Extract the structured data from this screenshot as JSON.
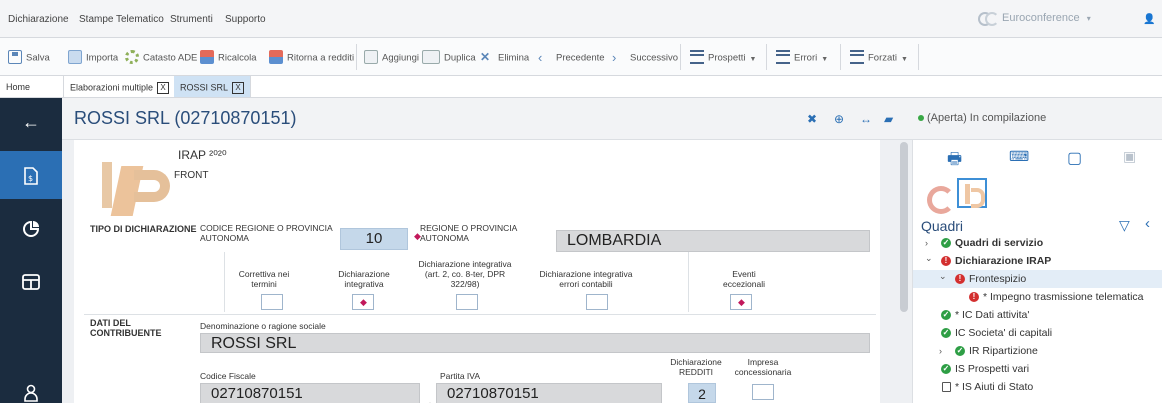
{
  "menu": {
    "items": [
      "Dichiarazione",
      "Stampe",
      "Telematico",
      "Strumenti",
      "Supporto"
    ],
    "brand": "Euroconference",
    "brand_caret": "▾"
  },
  "toolbar": {
    "salva": "Salva",
    "importa": "Importa",
    "catasto": "Catasto ADE",
    "ricalcola": "Ricalcola",
    "ritorna": "Ritorna a redditi",
    "aggiungi": "Aggiungi",
    "duplica": "Duplica",
    "elimina": "Elimina",
    "precedente": "Precedente",
    "successivo": "Successivo",
    "prospetti": "Prospetti",
    "errori": "Errori",
    "forzati": "Forzati"
  },
  "tabs": {
    "home": "Home",
    "elaborazioni": "Elaborazioni multiple",
    "rossi": "ROSSI SRL",
    "close_glyph": "X"
  },
  "header": {
    "title": "ROSSI SRL (02710870151)",
    "status": "(Aperta) In compilazione"
  },
  "form": {
    "irap_title": "IRAP ²⁰²⁰",
    "irap_sub": "FRONT",
    "tipo_label": "TIPO DI DICHIARAZIONE",
    "codice_regione_label": "CODICE REGIONE O PROVINCIA AUTONOMA",
    "codice_regione_value": "10",
    "regione_label": "REGIONE O PROVINCIA AUTONOMA",
    "regione_value": "LOMBARDIA",
    "correttiva_label": "Correttiva nei termini",
    "integrativa_label": "Dichiarazione integrativa",
    "integrativa_art_label": "Dichiarazione integrativa (art. 2, co. 8-ter, DPR 322/98)",
    "integrativa_err_label": "Dichiarazione integrativa errori contabili",
    "eventi_label": "Eventi eccezionali",
    "dati_label": "DATI DEL CONTRIBUENTE",
    "denominazione_label": "Denominazione o ragione sociale",
    "denominazione_value": "ROSSI SRL",
    "cf_label": "Codice Fiscale",
    "cf_value": "02710870151",
    "piva_label": "Partita IVA",
    "piva_value": "02710870151",
    "redditi_label": "Dichiarazione REDDITI",
    "redditi_value": "2",
    "impresa_label": "Impresa concessionaria"
  },
  "panel": {
    "quadri_title": "Quadri",
    "tree": [
      {
        "label": "Quadri di servizio",
        "status": "ok",
        "bold": true,
        "chev": "›"
      },
      {
        "label": "Dichiarazione IRAP",
        "status": "err",
        "bold": true,
        "chev": "⌄"
      },
      {
        "label": "Frontespizio",
        "status": "err",
        "bold": false,
        "chev": "⌄"
      },
      {
        "label": "* Impegno trasmissione telematica",
        "status": "err",
        "bold": false,
        "chev": ""
      },
      {
        "label": "* IC Dati attivita'",
        "status": "ok",
        "bold": false,
        "chev": ""
      },
      {
        "label": "IC Societa' di capitali",
        "status": "ok",
        "bold": false,
        "chev": ""
      },
      {
        "label": "IR Ripartizione",
        "status": "ok",
        "bold": false,
        "chev": "›"
      },
      {
        "label": "IS Prospetti vari",
        "status": "ok",
        "bold": false,
        "chev": ""
      },
      {
        "label": "* IS Aiuti di Stato",
        "status": "doc",
        "bold": false,
        "chev": ""
      }
    ]
  },
  "icons": {
    "back": "back-arrow-icon",
    "doc": "document-icon",
    "chart": "pie-chart-icon",
    "table": "table-icon",
    "user": "user-icon"
  }
}
